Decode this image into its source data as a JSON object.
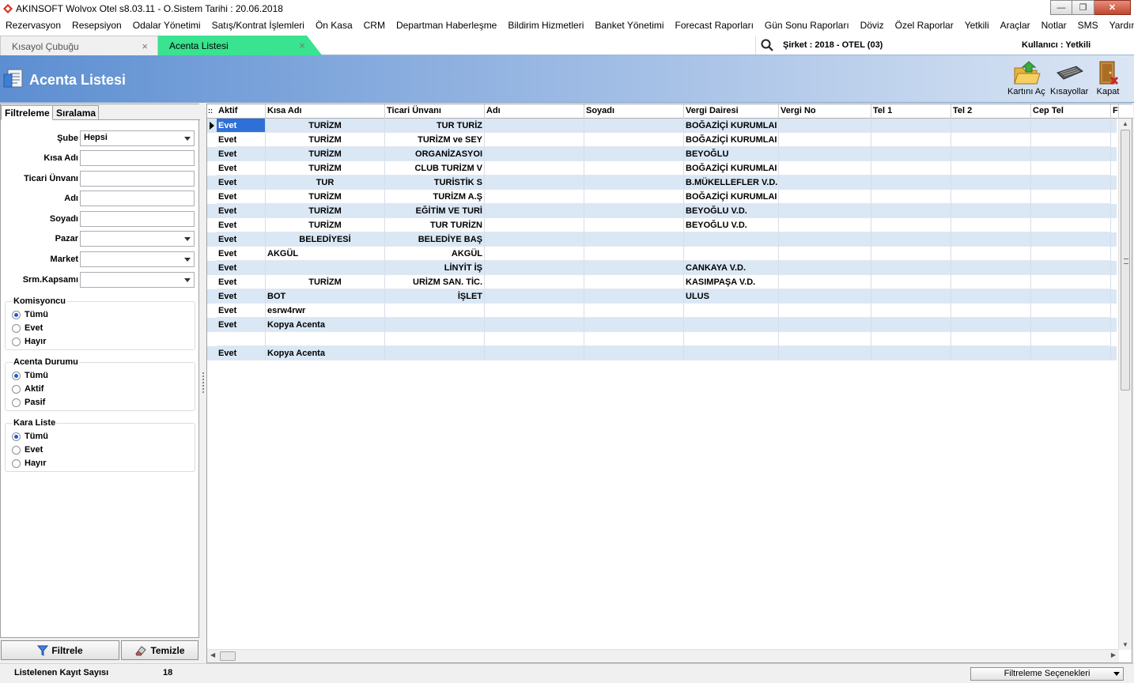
{
  "window": {
    "title": "AKINSOFT Wolvox Otel s8.03.11 - O.Sistem Tarihi : 20.06.2018",
    "minimize_glyph": "—",
    "maximize_glyph": "❐",
    "close_glyph": "✕"
  },
  "menu": [
    "Rezervasyon",
    "Resepsiyon",
    "Odalar Yönetimi",
    "Satış/Kontrat İşlemleri",
    "Ön Kasa",
    "CRM",
    "Departman Haberleşme",
    "Bildirim Hizmetleri",
    "Banket Yönetimi",
    "Forecast Raporları",
    "Gün Sonu Raporları",
    "Döviz",
    "Özel Raporlar",
    "Yetkili",
    "Araçlar",
    "Notlar",
    "SMS",
    "Yardım"
  ],
  "tabs": [
    {
      "label": "Kısayol Çubuğu",
      "close": "×"
    },
    {
      "label": "Acenta Listesi",
      "close": "×"
    }
  ],
  "company": {
    "sirket": "Şirket : 2018 - OTEL (03)",
    "kullanici": "Kullanıcı : Yetkili"
  },
  "header": {
    "title": "Acenta Listesi"
  },
  "toolbar": {
    "kartini_ac": "Kartını Aç",
    "kisayollar": "Kısayollar",
    "kapat": "Kapat"
  },
  "filter_tabs": {
    "filtreleme": "Filtreleme",
    "siralama": "Sıralama"
  },
  "filters": {
    "sube": {
      "label": "Şube",
      "value": "Hepsi"
    },
    "kisa_adi": {
      "label": "Kısa Adı",
      "value": ""
    },
    "ticari_unvani": {
      "label": "Ticari Ünvanı",
      "value": ""
    },
    "adi": {
      "label": "Adı",
      "value": ""
    },
    "soyadi": {
      "label": "Soyadı",
      "value": ""
    },
    "pazar": {
      "label": "Pazar",
      "value": ""
    },
    "market": {
      "label": "Market",
      "value": ""
    },
    "srm_kapsami": {
      "label": "Srm.Kapsamı",
      "value": ""
    }
  },
  "groups": {
    "komisyoncu": {
      "title": "Komisyoncu",
      "options": [
        "Tümü",
        "Evet",
        "Hayır"
      ],
      "selected": 0
    },
    "acenta_durumu": {
      "title": "Acenta Durumu",
      "options": [
        "Tümü",
        "Aktif",
        "Pasif"
      ],
      "selected": 0
    },
    "kara_liste": {
      "title": "Kara Liste",
      "options": [
        "Tümü",
        "Evet",
        "Hayır"
      ],
      "selected": 0
    }
  },
  "buttons": {
    "filtrele": "Filtrele",
    "temizle": "Temizle"
  },
  "grid": {
    "columns": [
      "Aktif",
      "Kısa Adı",
      "Ticari Ünvanı",
      "Adı",
      "Soyadı",
      "Vergi Dairesi",
      "Vergi No",
      "Tel 1",
      "Tel 2",
      "Cep Tel",
      "F"
    ],
    "indicator_header": "::",
    "rows": [
      [
        "Evet",
        "TURİZM",
        "TUR TURİZ",
        "",
        "",
        "BOĞAZİÇİ KURUMLAI",
        "",
        "",
        "",
        ""
      ],
      [
        "Evet",
        "TURİZM",
        "TURİZM ve SEY",
        "",
        "",
        "BOĞAZİÇİ KURUMLAI",
        "",
        "",
        "",
        ""
      ],
      [
        "Evet",
        "TURİZM",
        "ORGANİZASYOI",
        "",
        "",
        "BEYOĞLU",
        "",
        "",
        "",
        ""
      ],
      [
        "Evet",
        "TURİZM",
        "CLUB          TURİZM V",
        "",
        "",
        "BOĞAZİÇİ KURUMLAI",
        "",
        "",
        "",
        ""
      ],
      [
        "Evet",
        "TUR",
        "TURİSTİK S",
        "",
        "",
        "B.MÜKELLEFLER V.D.",
        "",
        "",
        "",
        ""
      ],
      [
        "Evet",
        "TURİZM",
        "TURİZM A.Ş",
        "",
        "",
        "BOĞAZİÇİ KURUMLAI",
        "",
        "",
        "",
        ""
      ],
      [
        "Evet",
        "TURİZM",
        "EĞİTİM VE TURİ",
        "",
        "",
        "BEYOĞLU V.D.",
        "",
        "",
        "",
        ""
      ],
      [
        "Evet",
        "TURİZM",
        "TUR TURİZN",
        "",
        "",
        "BEYOĞLU V.D.",
        "",
        "",
        "",
        ""
      ],
      [
        "Evet",
        "BELEDİYESİ",
        "BELEDİYE BAŞ",
        "",
        "",
        "",
        "",
        "",
        "",
        ""
      ],
      [
        "Evet",
        "AKGÜL",
        "AKGÜL",
        "",
        "",
        "",
        "",
        "",
        "",
        ""
      ],
      [
        "Evet",
        "",
        "LİNYİT İŞ",
        "",
        "",
        "CANKAYA V.D.",
        "",
        "",
        "",
        ""
      ],
      [
        "Evet",
        "TURİZM",
        "URİZM SAN. TİC.",
        "",
        "",
        "KASIMPAŞA V.D.",
        "",
        "",
        "",
        ""
      ],
      [
        "Evet",
        "BOT",
        "İŞLET",
        "",
        "",
        "ULUS",
        "",
        "",
        "",
        ""
      ],
      [
        "Evet",
        "esrw4rwr",
        "",
        "",
        "",
        "",
        "",
        "",
        "",
        ""
      ],
      [
        "Evet",
        "Kopya Acenta",
        "",
        "",
        "",
        "",
        "",
        "",
        "",
        ""
      ],
      [
        "",
        "",
        "",
        "",
        "",
        "",
        "",
        "",
        "",
        ""
      ],
      [
        "Evet",
        "Kopya Acenta",
        "",
        "",
        "",
        "",
        "",
        "",
        "",
        ""
      ]
    ]
  },
  "status": {
    "label": "Listelenen Kayıt Sayısı",
    "count": "18",
    "filter_options": "Filtreleme Seçenekleri"
  }
}
